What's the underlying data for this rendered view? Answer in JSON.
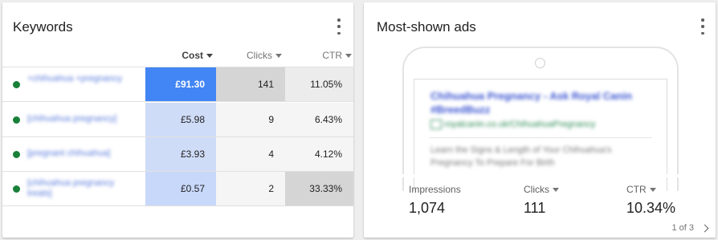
{
  "keywords_card": {
    "title": "Keywords",
    "menu_icon": "more-vert-icon",
    "columns": {
      "cost": "Cost",
      "clicks": "Clicks",
      "ctr": "CTR"
    },
    "rows": [
      {
        "keyword": "+chihuahua +pregnancy",
        "cost": "£91.30",
        "clicks": "141",
        "ctr": "11.05%"
      },
      {
        "keyword": "[chihuahua pregnancy]",
        "cost": "£5.98",
        "clicks": "9",
        "ctr": "6.43%"
      },
      {
        "keyword": "[pregnant chihuahua]",
        "cost": "£3.93",
        "clicks": "4",
        "ctr": "4.12%"
      },
      {
        "keyword": "[chihuahua pregnancy treats]",
        "cost": "£0.57",
        "clicks": "2",
        "ctr": "33.33%"
      }
    ],
    "status_color": "#188038"
  },
  "ads_card": {
    "title": "Most-shown ads",
    "menu_icon": "more-vert-icon",
    "ad": {
      "headline": "Chihuahua Pregnancy - Ask Royal Canin #BreedBuzz",
      "url": "royalcanin.co.uk/ChihuahuaPregnancy",
      "description": "Learn the Signs & Length of Your Chihuahua's Pregnancy To Prepare For Birth"
    },
    "metrics": {
      "impressions_label": "Impressions",
      "impressions_value": "1,074",
      "clicks_label": "Clicks",
      "clicks_value": "111",
      "ctr_label": "CTR",
      "ctr_value": "10.34%"
    },
    "pager": "1 of 3"
  },
  "colors": {
    "accent_blue": "#4285f4",
    "link_blue": "#3b62d6"
  }
}
